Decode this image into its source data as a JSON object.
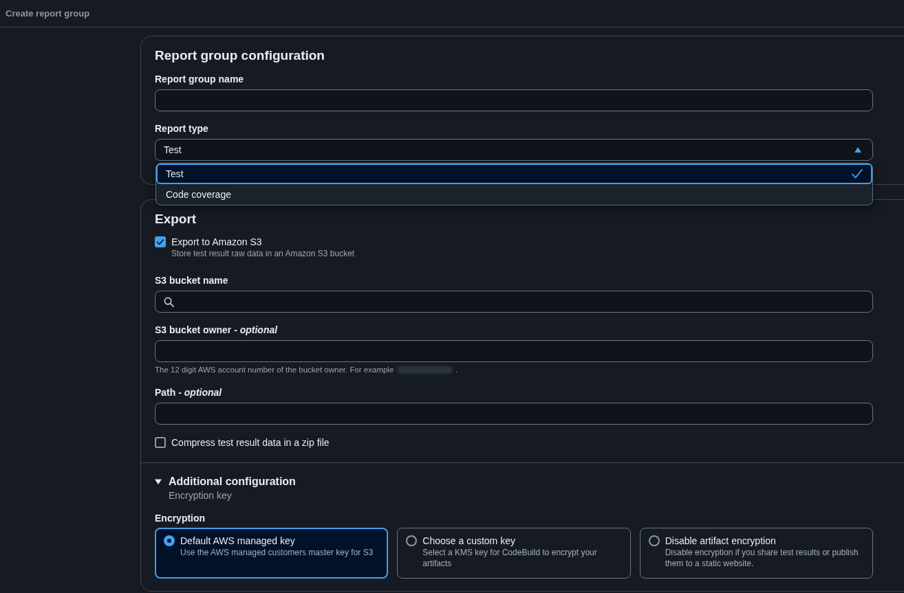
{
  "header": {
    "title": "Create report group"
  },
  "configuration": {
    "title": "Report group configuration",
    "fields": [
      {
        "kind": "text",
        "label": "Report group name"
      },
      {
        "kind": "select",
        "label": "Report type",
        "value": "Test",
        "expanded": true,
        "options": [
          {
            "label": "Test",
            "selected": true
          },
          {
            "label": "Code coverage",
            "selected": false
          }
        ]
      }
    ]
  },
  "export": {
    "title": "Export",
    "export_option": {
      "label": "Export to Amazon S3",
      "description": "Store test result raw data in an Amazon S3 bucket",
      "checked": true
    },
    "fields": [
      {
        "kind": "search",
        "label": "S3 bucket name"
      },
      {
        "kind": "text",
        "label": "S3 bucket owner - *optional*",
        "hint": "The 12 digit AWS account number of the bucket owner. For example",
        "hint_end": "."
      },
      {
        "kind": "text",
        "label": "Path - *optional*"
      }
    ],
    "compress_option": {
      "label": "Compress test result data in a zip file",
      "checked": false
    },
    "additional_configuration": {
      "title": "Additional configuration",
      "subtitle": "Encryption key",
      "expanded": true,
      "encryption": {
        "label": "Encryption",
        "options": [
          {
            "title": "Default AWS managed key",
            "description": "Use the AWS managed customers master key for S3",
            "selected": true
          },
          {
            "title": "Choose a custom key",
            "description": "Select a KMS key for CodeBuild to encrypt your artifacts",
            "selected": false
          },
          {
            "title": "Disable artifact encryption",
            "description": "Disable encryption if you share test results or publish them to a static website.",
            "selected": false
          }
        ]
      }
    }
  }
}
